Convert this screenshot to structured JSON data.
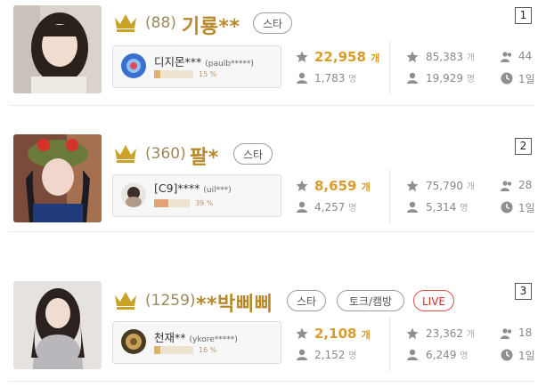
{
  "entries": [
    {
      "rank": "1",
      "count": "(88)",
      "name": "기룡**",
      "tags": [
        "스타"
      ],
      "streamer_name": "디지몬***",
      "streamer_id": "(paulb*****)",
      "share_pct": "15 %",
      "share_value": 0.15,
      "stars": "22,958",
      "stars_unit": "개",
      "fans": "1,783",
      "fans_unit": "명",
      "total_stars": "85,383",
      "total_stars_unit": "개",
      "total_fans": "19,929",
      "total_fans_unit": "명",
      "group_count": "44",
      "time": "1일"
    },
    {
      "rank": "2",
      "count": "(360)",
      "name": "팔*",
      "tags": [
        "스타"
      ],
      "streamer_name": "[C9]****",
      "streamer_id": "(uil***)",
      "share_pct": "39 %",
      "share_value": 0.39,
      "stars": "8,659",
      "stars_unit": "개",
      "fans": "4,257",
      "fans_unit": "명",
      "total_stars": "75,790",
      "total_stars_unit": "개",
      "total_fans": "5,314",
      "total_fans_unit": "명",
      "group_count": "28",
      "time": "1일"
    },
    {
      "rank": "3",
      "count": "(1259)",
      "name": "**박삐삐",
      "tags": [
        "스타",
        "토크/캠방"
      ],
      "live": "LIVE",
      "streamer_name": "천재**",
      "streamer_id": "(ykore*****)",
      "share_pct": "16 %",
      "share_value": 0.16,
      "stars": "2,108",
      "stars_unit": "개",
      "fans": "2,152",
      "fans_unit": "명",
      "total_stars": "23,362",
      "total_stars_unit": "개",
      "total_fans": "6,249",
      "total_fans_unit": "명",
      "group_count": "18",
      "time": "1일"
    }
  ],
  "colors": {
    "name_gold": "#b8892b",
    "star_gold": "#d89d2c",
    "crown": "#c9a227",
    "live_red": "#d0312d"
  }
}
